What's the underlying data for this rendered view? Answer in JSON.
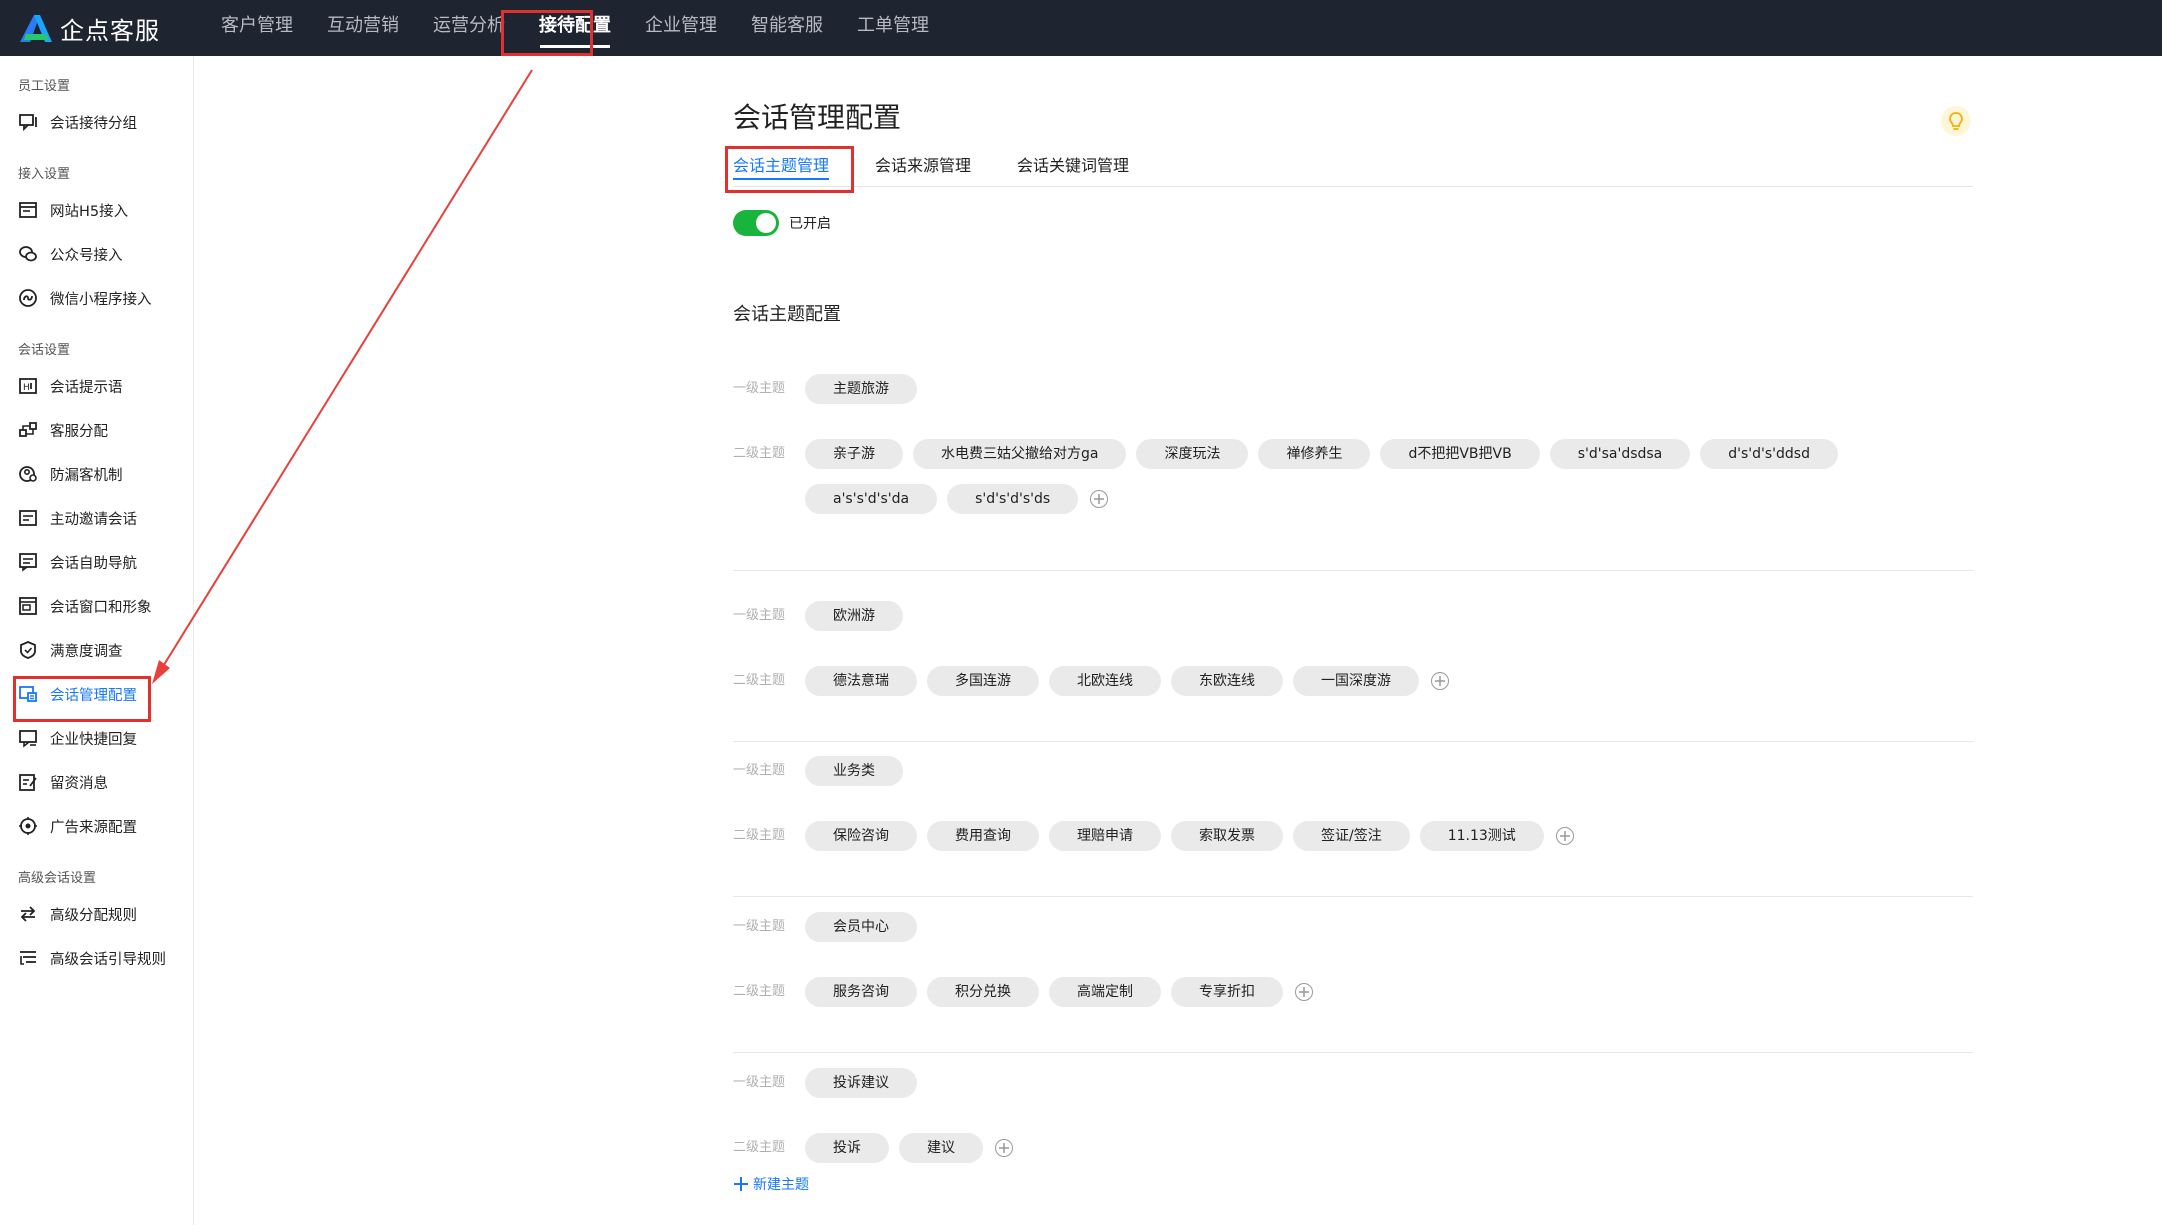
{
  "brand": {
    "name": "企点客服"
  },
  "topnav": [
    {
      "label": "客户管理"
    },
    {
      "label": "互动营销"
    },
    {
      "label": "运营分析"
    },
    {
      "label": "接待配置"
    },
    {
      "label": "企业管理"
    },
    {
      "label": "智能客服"
    },
    {
      "label": "工单管理"
    }
  ],
  "sidebar": {
    "groups": [
      {
        "title": "员工设置",
        "items": [
          {
            "label": "会话接待分组",
            "icon": "chat-group-icon"
          }
        ]
      },
      {
        "title": "接入设置",
        "items": [
          {
            "label": "网站H5接入",
            "icon": "web-page-icon"
          },
          {
            "label": "公众号接入",
            "icon": "wechat-icon"
          },
          {
            "label": "微信小程序接入",
            "icon": "mini-program-icon"
          }
        ]
      },
      {
        "title": "会话设置",
        "items": [
          {
            "label": "会话提示语",
            "icon": "prompt-icon"
          },
          {
            "label": "客服分配",
            "icon": "assign-icon"
          },
          {
            "label": "防漏客机制",
            "icon": "anti-loss-icon"
          },
          {
            "label": "主动邀请会话",
            "icon": "invite-icon"
          },
          {
            "label": "会话自助导航",
            "icon": "navigation-icon"
          },
          {
            "label": "会话窗口和形象",
            "icon": "window-icon"
          },
          {
            "label": "满意度调查",
            "icon": "survey-icon"
          },
          {
            "label": "会话管理配置",
            "icon": "session-config-icon"
          },
          {
            "label": "企业快捷回复",
            "icon": "quick-reply-icon"
          },
          {
            "label": "留资消息",
            "icon": "form-message-icon"
          },
          {
            "label": "广告来源配置",
            "icon": "ad-source-icon"
          }
        ]
      },
      {
        "title": "高级会话设置",
        "items": [
          {
            "label": "高级分配规则",
            "icon": "advanced-assign-icon"
          },
          {
            "label": "高级会话引导规则",
            "icon": "guide-rule-icon"
          }
        ]
      }
    ]
  },
  "main": {
    "title": "会话管理配置",
    "tabs": [
      {
        "label": "会话主题管理"
      },
      {
        "label": "会话来源管理"
      },
      {
        "label": "会话关键词管理"
      }
    ],
    "switch_label": "已开启",
    "section_title": "会话主题配置",
    "level1_label": "一级主题",
    "level2_label": "二级主题",
    "topics": [
      {
        "name": "主题旅游",
        "subs": [
          "亲子游",
          "水电费三姑父撤给对方ga",
          "深度玩法",
          "禅修养生",
          "d不把把VB把VB",
          "s'd'sa'dsdsa",
          "d's'd's'ddsd",
          "a's's'd's'da",
          "s'd's'd's'ds"
        ]
      },
      {
        "name": "欧洲游",
        "subs": [
          "德法意瑞",
          "多国连游",
          "北欧连线",
          "东欧连线",
          "一国深度游"
        ]
      },
      {
        "name": "业务类",
        "subs": [
          "保险咨询",
          "费用查询",
          "理赔申请",
          "索取发票",
          "签证/签注",
          "11.13测试"
        ]
      },
      {
        "name": "会员中心",
        "subs": [
          "服务咨询",
          "积分兑换",
          "高端定制",
          "专享折扣"
        ]
      },
      {
        "name": "投诉建议",
        "subs": [
          "投诉",
          "建议"
        ]
      }
    ],
    "new_topic_label": "新建主题"
  },
  "colors": {
    "accent": "#1677ff",
    "switch_on": "#19b43b",
    "topbar": "#1e2430",
    "highlight": "#e0312f"
  }
}
